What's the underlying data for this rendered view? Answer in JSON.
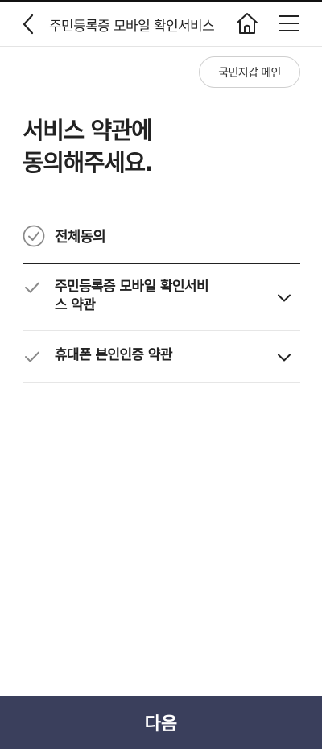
{
  "header": {
    "title": "주민등록증 모바일 확인서비스",
    "back_icon": "chevron-left-icon",
    "home_icon": "home-icon",
    "menu_icon": "hamburger-menu-icon"
  },
  "main_button_label": "국민지갑 메인",
  "headline": {
    "line1": "서비스 약관에",
    "line2": "동의해주세요."
  },
  "agree_all": {
    "label": "전체동의",
    "checked": false
  },
  "terms": [
    {
      "line1": "주민등록증 모바일 확인서비",
      "line2": "스 약관",
      "checked": true
    },
    {
      "line1": "휴대폰 본인인증 약관",
      "line2": "",
      "checked": true
    }
  ],
  "next_button_label": "다음",
  "colors": {
    "primary_button": "#3a3f5c",
    "check_gray": "#8a8a8a",
    "text": "#222222"
  }
}
